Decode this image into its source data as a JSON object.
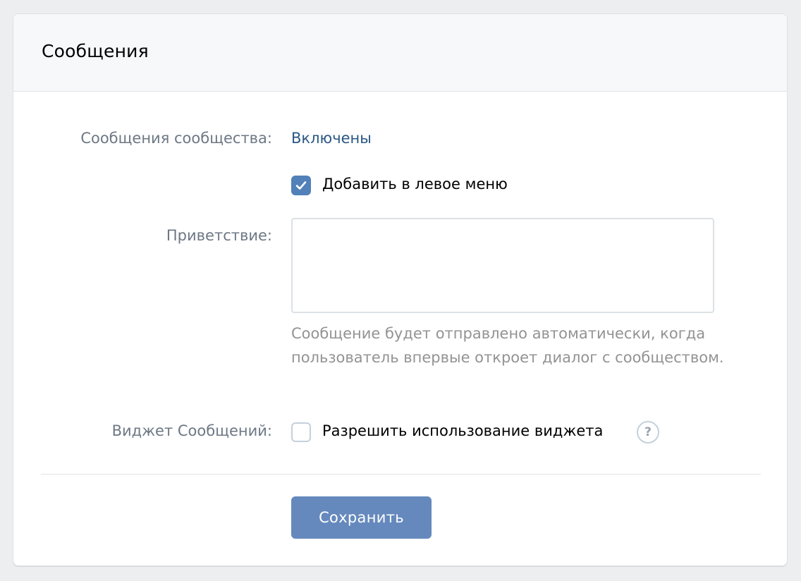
{
  "header": {
    "title": "Сообщения"
  },
  "community_messages": {
    "label": "Сообщения сообщества:",
    "value": "Включены"
  },
  "left_menu": {
    "label": "Добавить в левое меню",
    "checked": true
  },
  "greeting": {
    "label": "Приветствие:",
    "value": "",
    "hint": "Сообщение будет отправлено автоматически, когда пользователь впервые откроет диалог с сообществом."
  },
  "widget": {
    "label": "Виджет Сообщений:",
    "checkbox_label": "Разрешить использование виджета",
    "checked": false,
    "help_glyph": "?"
  },
  "actions": {
    "save_label": "Сохранить"
  },
  "colors": {
    "page_background": "#edeef0",
    "accent": "#5181b8",
    "link": "#2a5885",
    "button": "#6589bd",
    "label_gray": "#6d7885",
    "hint_gray": "#939393"
  },
  "icons": {
    "checkbox_checked": "checkmark-icon",
    "help": "question-circle-icon"
  }
}
